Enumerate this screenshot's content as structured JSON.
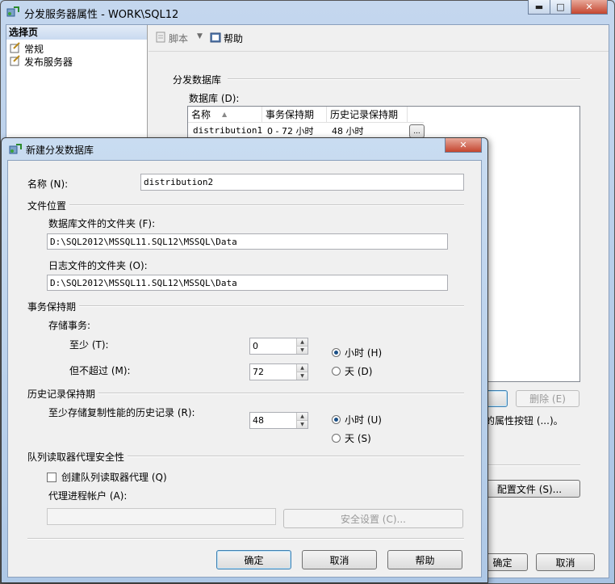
{
  "outer": {
    "title": "分发服务器属性 - WORK\\SQL12",
    "select_page_header": "选择页",
    "pages": [
      "常规",
      "发布服务器"
    ],
    "toolbar": {
      "script_label": "脚本",
      "help_label": "帮助"
    },
    "group_title": "分发数据库",
    "db_label": "数据库 (D):",
    "columns": [
      "名称",
      "事务保持期",
      "历史记录保持期"
    ],
    "rows": [
      {
        "name": "distribution1",
        "retention": "0 - 72 小时",
        "history": "48 小时",
        "ellipsis": "..."
      }
    ],
    "delete_button": "删除 (E)",
    "property_hint": "的属性按钮 (...)。",
    "profile_button": "配置文件 (S)...",
    "ok_button": "确定",
    "cancel_button": "取消"
  },
  "dialog": {
    "title": "新建分发数据库",
    "name_label": "名称 (N):",
    "name_value": "distribution2",
    "file_location_header": "文件位置",
    "data_folder_label": "数据库文件的文件夹 (F):",
    "data_folder_value": "D:\\SQL2012\\MSSQL11.SQL12\\MSSQL\\Data",
    "log_folder_label": "日志文件的文件夹 (O):",
    "log_folder_value": "D:\\SQL2012\\MSSQL11.SQL12\\MSSQL\\Data",
    "tx_retention_header": "事务保持期",
    "store_tx_label": "存储事务:",
    "at_least_label": "至少 (T):",
    "at_least_value": "0",
    "not_more_label": "但不超过 (M):",
    "not_more_value": "72",
    "hours_label_1": "小时 (H)",
    "days_label_1": "天 (D)",
    "history_header": "历史记录保持期",
    "history_label": "至少存储复制性能的历史记录 (R):",
    "history_value": "48",
    "hours_label_2": "小时 (U)",
    "days_label_2": "天 (S)",
    "queue_header": "队列读取器代理安全性",
    "create_queue_label": "创建队列读取器代理 (Q)",
    "agent_account_label": "代理进程帐户 (A):",
    "security_button": "安全设置 (C)...",
    "ok_button": "确定",
    "cancel_button": "取消",
    "help_button": "帮助"
  }
}
